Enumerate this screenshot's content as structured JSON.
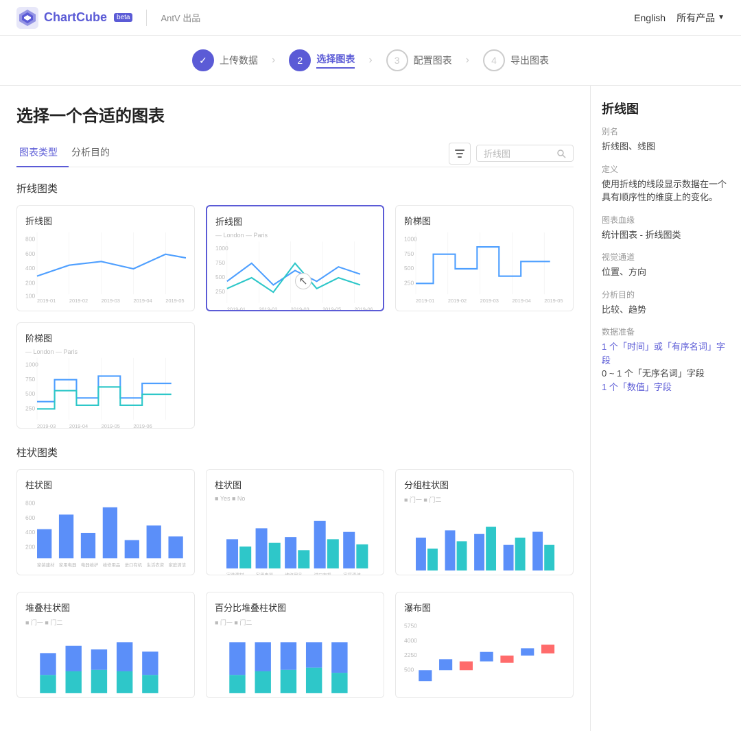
{
  "header": {
    "logo_text": "ChartCube",
    "beta": "beta",
    "antv": "AntV 出品",
    "lang": "English",
    "products": "所有产品"
  },
  "steps": [
    {
      "id": 1,
      "label": "上传数据",
      "state": "done",
      "icon": "✓"
    },
    {
      "id": 2,
      "label": "选择图表",
      "state": "active"
    },
    {
      "id": 3,
      "label": "配置图表",
      "state": "default"
    },
    {
      "id": 4,
      "label": "导出图表",
      "state": "default"
    }
  ],
  "page": {
    "title": "选择一个合适的图表",
    "tabs": [
      "图表类型",
      "分析目的"
    ],
    "active_tab": 0,
    "search_placeholder": "折线图"
  },
  "categories": [
    {
      "name": "折线图类",
      "charts": [
        {
          "id": "line",
          "title": "折线图",
          "selected": false
        },
        {
          "id": "line2",
          "title": "折线图",
          "selected": true
        },
        {
          "id": "step",
          "title": "阶梯图",
          "selected": false
        },
        {
          "id": "step2",
          "title": "阶梯图",
          "selected": false
        }
      ]
    },
    {
      "name": "柱状图类",
      "charts": [
        {
          "id": "bar1",
          "title": "柱状图",
          "selected": false
        },
        {
          "id": "bar2",
          "title": "柱状图",
          "selected": false
        },
        {
          "id": "bar3",
          "title": "分组柱状图",
          "selected": false
        },
        {
          "id": "bar4",
          "title": "堆叠柱状图",
          "selected": false
        },
        {
          "id": "bar5",
          "title": "百分比堆叠柱状图",
          "selected": false
        },
        {
          "id": "bar6",
          "title": "瀑布图",
          "selected": false
        }
      ]
    }
  ],
  "sidebar": {
    "title": "折线图",
    "alias_label": "别名",
    "alias_value": "折线图、线图",
    "definition_label": "定义",
    "definition_value": "使用折线的线段显示数据在一个具有顺序性的维度上的变化。",
    "lineage_label": "图表血缘",
    "lineage_value": "统计图表 - 折线图类",
    "channel_label": "视觉通道",
    "channel_value": "位置、方向",
    "purpose_label": "分析目的",
    "purpose_value": "比较、趋势",
    "data_label": "数据准备",
    "data_lines": [
      "1 个「时间」或「有序名词」字段",
      "0 ~ 1 个「无序名词」字段",
      "1 个「数值」字段"
    ]
  }
}
